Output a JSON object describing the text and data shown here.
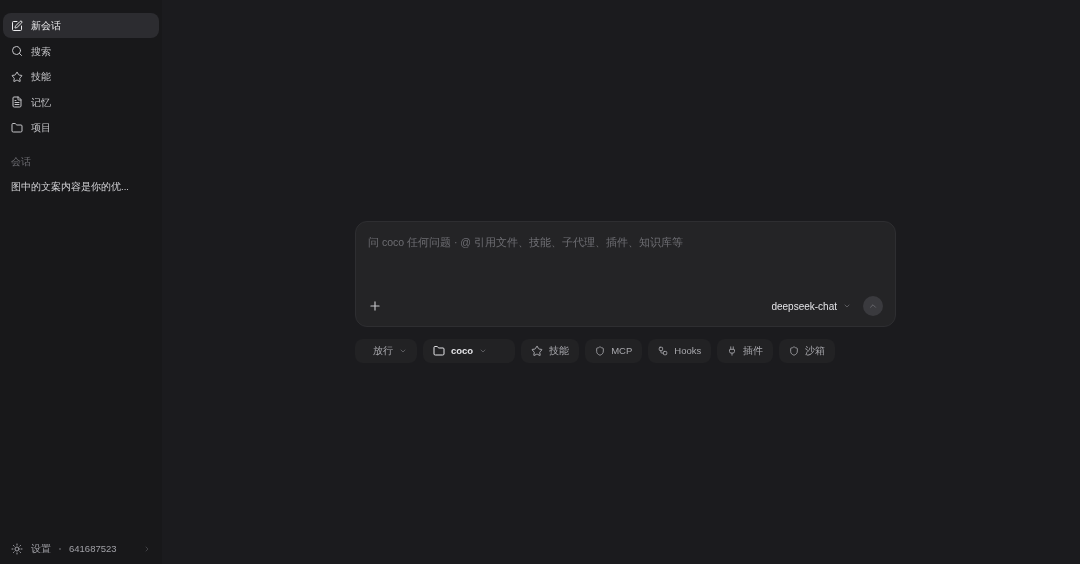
{
  "sidebar": {
    "items": [
      {
        "label": "新会话",
        "kind": "new",
        "selected": true
      },
      {
        "label": "搜索",
        "kind": "search",
        "selected": false
      },
      {
        "label": "技能",
        "kind": "star",
        "selected": false
      },
      {
        "label": "记忆",
        "kind": "doc",
        "selected": false
      },
      {
        "label": "项目",
        "kind": "folder",
        "selected": false
      }
    ],
    "section_title": "会话",
    "conversations": [
      {
        "label": "图中的文案内容是你的优...",
        "selected": false
      }
    ],
    "footer": {
      "settings": "设置",
      "user_id": "641687523"
    }
  },
  "composer": {
    "placeholder": "问 coco 任何问题 · @ 引用文件、技能、子代理、插件、知识库等",
    "model": "deepseek-chat"
  },
  "chips": [
    {
      "label": "放行",
      "kind": "mode",
      "dropdown": true
    },
    {
      "label": "coco",
      "kind": "folder",
      "dropdown": true
    },
    {
      "label": "技能",
      "kind": "star",
      "dropdown": false
    },
    {
      "label": "MCP",
      "kind": "shield",
      "dropdown": false
    },
    {
      "label": "Hooks",
      "kind": "nodes",
      "dropdown": false
    },
    {
      "label": "插件",
      "kind": "plug",
      "dropdown": false
    },
    {
      "label": "沙箱",
      "kind": "shield",
      "dropdown": false
    }
  ]
}
